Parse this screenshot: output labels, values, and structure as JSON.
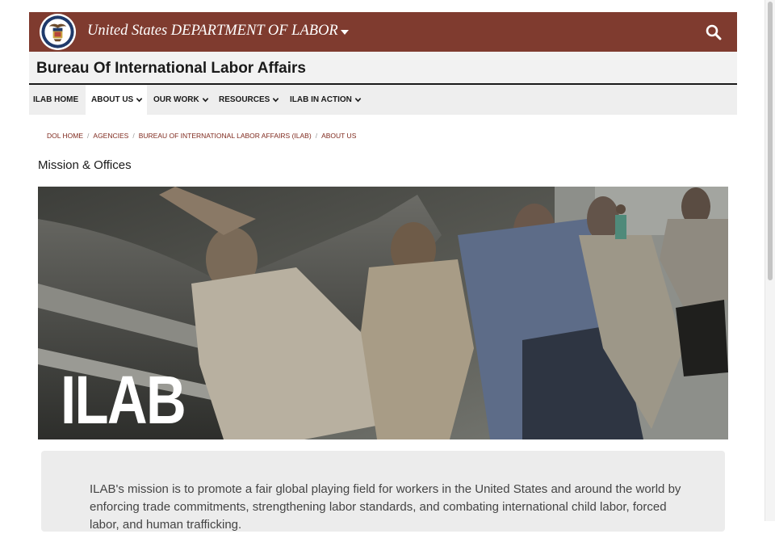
{
  "header": {
    "dept_title": "United States DEPARTMENT OF LABOR",
    "seal_icon": "dol-seal-icon",
    "search_icon": "search-icon",
    "brand_color": "#7f3b2f"
  },
  "bureau": {
    "title": "Bureau Of International Labor Affairs"
  },
  "nav": {
    "items": [
      {
        "label": "ILAB HOME",
        "has_menu": false
      },
      {
        "label": "ABOUT US",
        "has_menu": true
      },
      {
        "label": "OUR WORK",
        "has_menu": true
      },
      {
        "label": "RESOURCES",
        "has_menu": true
      },
      {
        "label": "ILAB IN ACTION",
        "has_menu": true
      }
    ]
  },
  "breadcrumb": [
    "DOL HOME",
    "AGENCIES",
    "BUREAU OF INTERNATIONAL LABOR AFFAIRS (ILAB)",
    "ABOUT US"
  ],
  "page": {
    "title": "Mission & Offices"
  },
  "hero": {
    "overlay_text": "ILAB"
  },
  "mission": {
    "text": "ILAB's mission is to promote a fair global playing field for workers in the United States and around the world by enforcing trade commitments, strengthening labor standards, and combating international child labor, forced labor, and human trafficking."
  }
}
